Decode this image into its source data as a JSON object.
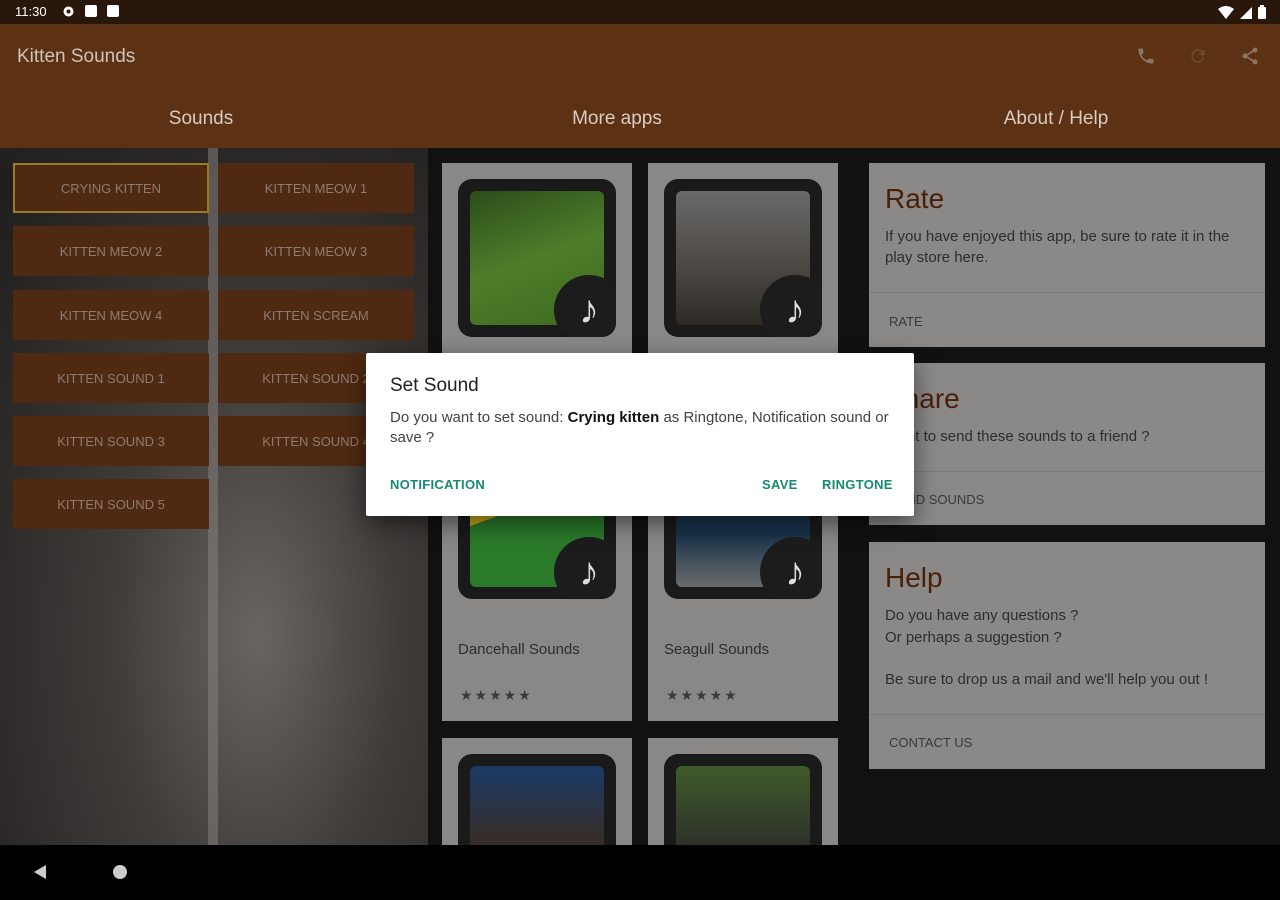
{
  "status_bar": {
    "time": "11:30"
  },
  "app_bar": {
    "title": "Kitten Sounds"
  },
  "tabs": [
    {
      "label": "Sounds"
    },
    {
      "label": "More apps"
    },
    {
      "label": "About / Help"
    }
  ],
  "sound_buttons": [
    {
      "label": "CRYING KITTEN"
    },
    {
      "label": "KITTEN MEOW 1"
    },
    {
      "label": "KITTEN MEOW 2"
    },
    {
      "label": "KITTEN MEOW 3"
    },
    {
      "label": "KITTEN MEOW 4"
    },
    {
      "label": "KITTEN SCREAM"
    },
    {
      "label": "KITTEN SOUND 1"
    },
    {
      "label": "KITTEN SOUND 2"
    },
    {
      "label": "KITTEN SOUND 3"
    },
    {
      "label": "KITTEN SOUND 4"
    },
    {
      "label": "KITTEN SOUND 5"
    }
  ],
  "more_apps": [
    {
      "name": "",
      "stars": ""
    },
    {
      "name": "",
      "stars": ""
    },
    {
      "name": "Dancehall Sounds",
      "stars": "★★★★★"
    },
    {
      "name": "Seagull Sounds",
      "stars": "★★★★★"
    },
    {
      "name": "",
      "stars": ""
    },
    {
      "name": "",
      "stars": ""
    }
  ],
  "about": {
    "rate": {
      "title": "Rate",
      "text": "If you have enjoyed this app, be sure to rate it in the play store here.",
      "action": "RATE"
    },
    "share": {
      "title": "Share",
      "text": "Want to send these sounds to a friend ?",
      "action": "SEND SOUNDS"
    },
    "help": {
      "title": "Help",
      "text1": "Do you have any questions ?",
      "text2": "Or perhaps a suggestion ?",
      "text3": "Be sure to drop us a mail and we'll help you out !",
      "action": "CONTACT US"
    }
  },
  "dialog": {
    "title": "Set Sound",
    "message_pre": "Do you want to set sound: ",
    "message_bold": "Crying kitten",
    "message_post": " as Ringtone, Notification sound or save ?",
    "btn_notification": "NOTIFICATION",
    "btn_save": "SAVE",
    "btn_ringtone": "RINGTONE"
  },
  "colors": {
    "app_bar": "#5d3113",
    "status_bar": "#2a170c",
    "dialog_accent": "#178a73",
    "sound_button": "#4f2911",
    "selected_border": "#9a7a22"
  }
}
